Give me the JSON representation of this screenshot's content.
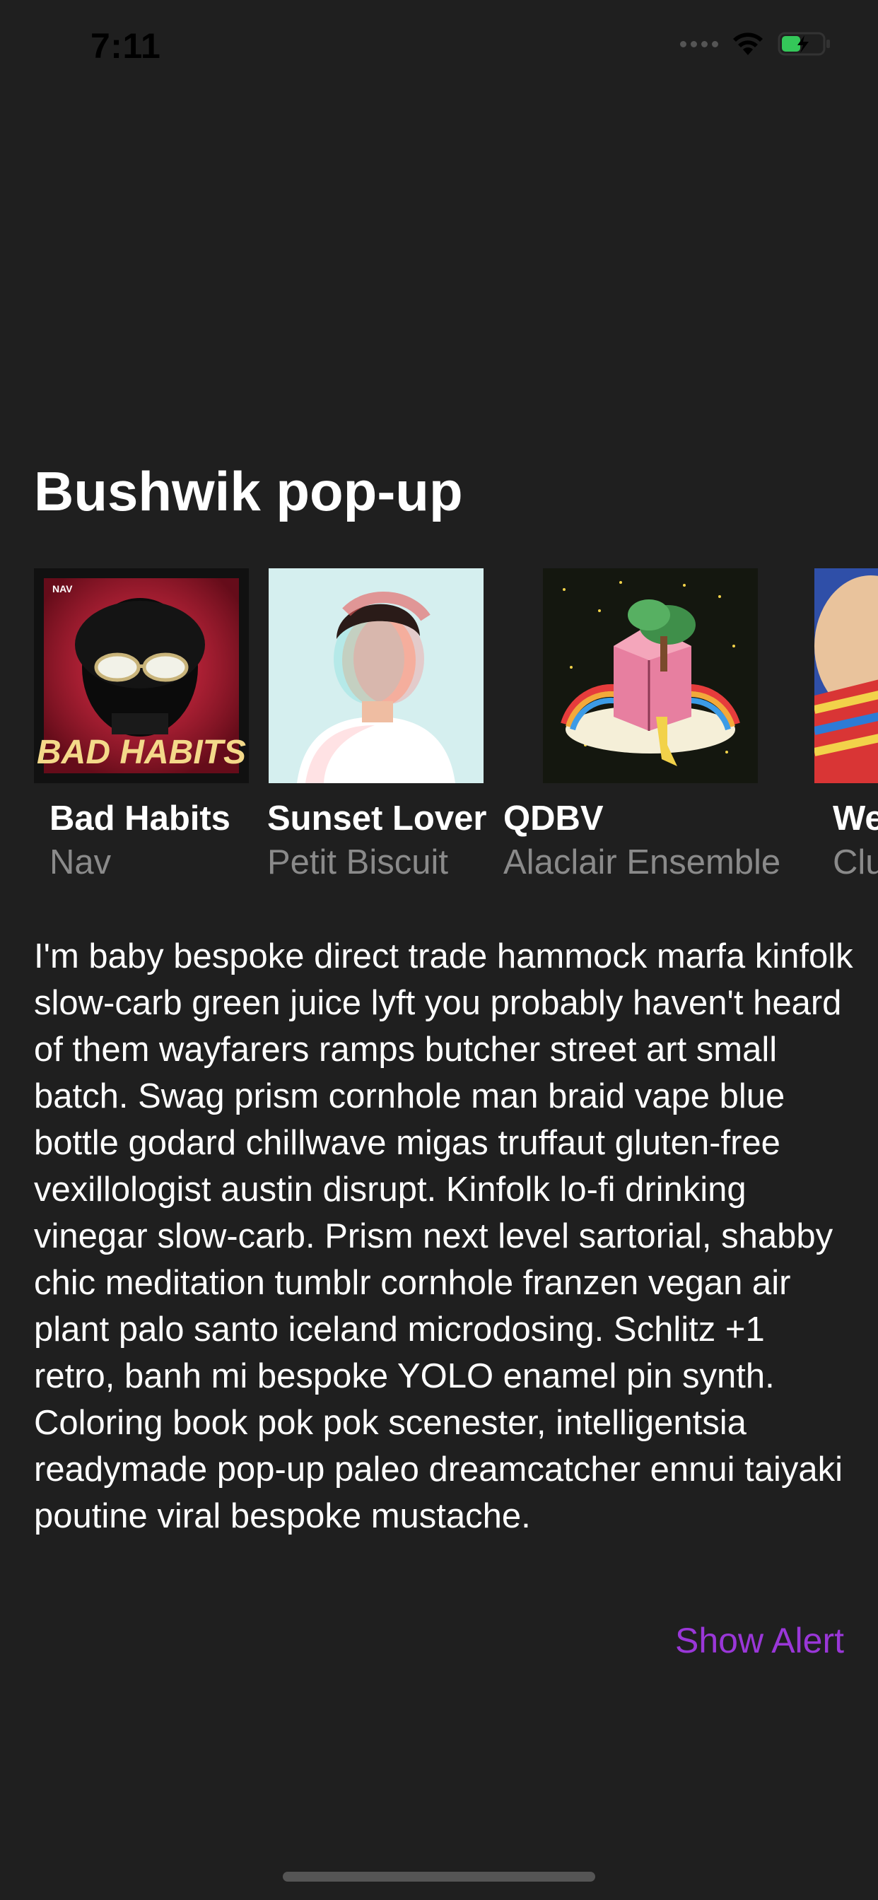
{
  "status_bar": {
    "time": "7:11",
    "icons": [
      "signal-icon",
      "wifi-icon",
      "battery-charging-icon"
    ],
    "battery_color": "#34c759"
  },
  "page": {
    "title": "Bushwik pop-up"
  },
  "albums": [
    {
      "title": "Bad Habits",
      "artist": "Nav",
      "cover_text": "BAD HABITS",
      "cover_label": "NAV"
    },
    {
      "title": "Sunset Lover",
      "artist": "Petit Biscuit"
    },
    {
      "title": "QDBV",
      "artist": "Alaclair Ensemble"
    },
    {
      "title": "We",
      "artist": "Clu"
    }
  ],
  "body_text": "I'm baby bespoke direct trade hammock marfa kinfolk slow-carb green juice lyft you probably haven't heard of them wayfarers ramps butcher street art small batch. Swag prism cornhole man braid vape blue bottle godard chillwave migas truffaut gluten-free vexillologist austin disrupt. Kinfolk lo-fi drinking vinegar slow-carb. Prism next level sartorial, shabby chic meditation tumblr cornhole franzen vegan air plant palo santo iceland microdosing. Schlitz +1 retro, banh mi bespoke YOLO enamel pin synth. Coloring book pok pok scenester, intelligentsia readymade pop-up paleo dreamcatcher ennui taiyaki poutine viral bespoke mustache.",
  "action": {
    "label": "Show Alert",
    "color": "#9a37d8"
  },
  "colors": {
    "background": "#1f1f1f",
    "secondary_text": "#8a8a8a"
  }
}
